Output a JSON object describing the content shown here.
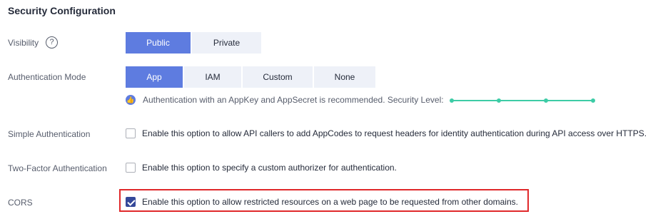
{
  "section": {
    "title": "Security Configuration"
  },
  "visibility": {
    "label": "Visibility",
    "help_icon": "?",
    "options": [
      "Public",
      "Private"
    ],
    "selected": "Public"
  },
  "auth_mode": {
    "label": "Authentication Mode",
    "options": [
      "App",
      "IAM",
      "Custom",
      "None"
    ],
    "selected": "App",
    "hint": "Authentication with an AppKey and AppSecret is recommended. Security Level:",
    "security_level_steps": 4,
    "security_level_value": 4,
    "level_color": "#3dcca6"
  },
  "simple_auth": {
    "label": "Simple Authentication",
    "checked": false,
    "text": "Enable this option to allow API callers to add AppCodes to request headers for identity authentication during API access over HTTPS."
  },
  "two_factor": {
    "label": "Two-Factor Authentication",
    "checked": false,
    "text": "Enable this option to specify a custom authorizer for authentication."
  },
  "cors": {
    "label": "CORS",
    "checked": true,
    "text": "Enable this option to allow restricted resources on a web page to be requested from other domains.",
    "highlight_color": "#e0292b"
  },
  "colors": {
    "primary": "#5e7ce0",
    "checkbox_checked": "#344899"
  }
}
